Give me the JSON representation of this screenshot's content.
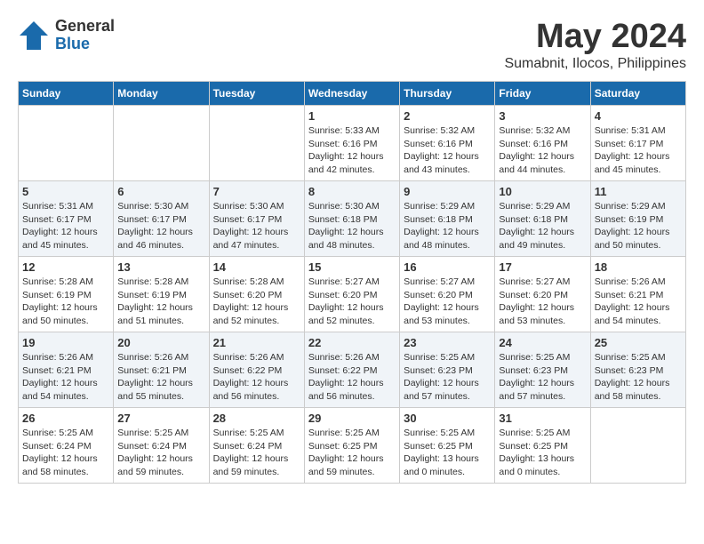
{
  "header": {
    "logo_general": "General",
    "logo_blue": "Blue",
    "month_title": "May 2024",
    "location": "Sumabnit, Ilocos, Philippines"
  },
  "weekdays": [
    "Sunday",
    "Monday",
    "Tuesday",
    "Wednesday",
    "Thursday",
    "Friday",
    "Saturday"
  ],
  "weeks": [
    {
      "alt": false,
      "days": [
        {
          "num": "",
          "sunrise": "",
          "sunset": "",
          "daylight": ""
        },
        {
          "num": "",
          "sunrise": "",
          "sunset": "",
          "daylight": ""
        },
        {
          "num": "",
          "sunrise": "",
          "sunset": "",
          "daylight": ""
        },
        {
          "num": "1",
          "sunrise": "Sunrise: 5:33 AM",
          "sunset": "Sunset: 6:16 PM",
          "daylight": "Daylight: 12 hours and 42 minutes."
        },
        {
          "num": "2",
          "sunrise": "Sunrise: 5:32 AM",
          "sunset": "Sunset: 6:16 PM",
          "daylight": "Daylight: 12 hours and 43 minutes."
        },
        {
          "num": "3",
          "sunrise": "Sunrise: 5:32 AM",
          "sunset": "Sunset: 6:16 PM",
          "daylight": "Daylight: 12 hours and 44 minutes."
        },
        {
          "num": "4",
          "sunrise": "Sunrise: 5:31 AM",
          "sunset": "Sunset: 6:17 PM",
          "daylight": "Daylight: 12 hours and 45 minutes."
        }
      ]
    },
    {
      "alt": true,
      "days": [
        {
          "num": "5",
          "sunrise": "Sunrise: 5:31 AM",
          "sunset": "Sunset: 6:17 PM",
          "daylight": "Daylight: 12 hours and 45 minutes."
        },
        {
          "num": "6",
          "sunrise": "Sunrise: 5:30 AM",
          "sunset": "Sunset: 6:17 PM",
          "daylight": "Daylight: 12 hours and 46 minutes."
        },
        {
          "num": "7",
          "sunrise": "Sunrise: 5:30 AM",
          "sunset": "Sunset: 6:17 PM",
          "daylight": "Daylight: 12 hours and 47 minutes."
        },
        {
          "num": "8",
          "sunrise": "Sunrise: 5:30 AM",
          "sunset": "Sunset: 6:18 PM",
          "daylight": "Daylight: 12 hours and 48 minutes."
        },
        {
          "num": "9",
          "sunrise": "Sunrise: 5:29 AM",
          "sunset": "Sunset: 6:18 PM",
          "daylight": "Daylight: 12 hours and 48 minutes."
        },
        {
          "num": "10",
          "sunrise": "Sunrise: 5:29 AM",
          "sunset": "Sunset: 6:18 PM",
          "daylight": "Daylight: 12 hours and 49 minutes."
        },
        {
          "num": "11",
          "sunrise": "Sunrise: 5:29 AM",
          "sunset": "Sunset: 6:19 PM",
          "daylight": "Daylight: 12 hours and 50 minutes."
        }
      ]
    },
    {
      "alt": false,
      "days": [
        {
          "num": "12",
          "sunrise": "Sunrise: 5:28 AM",
          "sunset": "Sunset: 6:19 PM",
          "daylight": "Daylight: 12 hours and 50 minutes."
        },
        {
          "num": "13",
          "sunrise": "Sunrise: 5:28 AM",
          "sunset": "Sunset: 6:19 PM",
          "daylight": "Daylight: 12 hours and 51 minutes."
        },
        {
          "num": "14",
          "sunrise": "Sunrise: 5:28 AM",
          "sunset": "Sunset: 6:20 PM",
          "daylight": "Daylight: 12 hours and 52 minutes."
        },
        {
          "num": "15",
          "sunrise": "Sunrise: 5:27 AM",
          "sunset": "Sunset: 6:20 PM",
          "daylight": "Daylight: 12 hours and 52 minutes."
        },
        {
          "num": "16",
          "sunrise": "Sunrise: 5:27 AM",
          "sunset": "Sunset: 6:20 PM",
          "daylight": "Daylight: 12 hours and 53 minutes."
        },
        {
          "num": "17",
          "sunrise": "Sunrise: 5:27 AM",
          "sunset": "Sunset: 6:20 PM",
          "daylight": "Daylight: 12 hours and 53 minutes."
        },
        {
          "num": "18",
          "sunrise": "Sunrise: 5:26 AM",
          "sunset": "Sunset: 6:21 PM",
          "daylight": "Daylight: 12 hours and 54 minutes."
        }
      ]
    },
    {
      "alt": true,
      "days": [
        {
          "num": "19",
          "sunrise": "Sunrise: 5:26 AM",
          "sunset": "Sunset: 6:21 PM",
          "daylight": "Daylight: 12 hours and 54 minutes."
        },
        {
          "num": "20",
          "sunrise": "Sunrise: 5:26 AM",
          "sunset": "Sunset: 6:21 PM",
          "daylight": "Daylight: 12 hours and 55 minutes."
        },
        {
          "num": "21",
          "sunrise": "Sunrise: 5:26 AM",
          "sunset": "Sunset: 6:22 PM",
          "daylight": "Daylight: 12 hours and 56 minutes."
        },
        {
          "num": "22",
          "sunrise": "Sunrise: 5:26 AM",
          "sunset": "Sunset: 6:22 PM",
          "daylight": "Daylight: 12 hours and 56 minutes."
        },
        {
          "num": "23",
          "sunrise": "Sunrise: 5:25 AM",
          "sunset": "Sunset: 6:23 PM",
          "daylight": "Daylight: 12 hours and 57 minutes."
        },
        {
          "num": "24",
          "sunrise": "Sunrise: 5:25 AM",
          "sunset": "Sunset: 6:23 PM",
          "daylight": "Daylight: 12 hours and 57 minutes."
        },
        {
          "num": "25",
          "sunrise": "Sunrise: 5:25 AM",
          "sunset": "Sunset: 6:23 PM",
          "daylight": "Daylight: 12 hours and 58 minutes."
        }
      ]
    },
    {
      "alt": false,
      "days": [
        {
          "num": "26",
          "sunrise": "Sunrise: 5:25 AM",
          "sunset": "Sunset: 6:24 PM",
          "daylight": "Daylight: 12 hours and 58 minutes."
        },
        {
          "num": "27",
          "sunrise": "Sunrise: 5:25 AM",
          "sunset": "Sunset: 6:24 PM",
          "daylight": "Daylight: 12 hours and 59 minutes."
        },
        {
          "num": "28",
          "sunrise": "Sunrise: 5:25 AM",
          "sunset": "Sunset: 6:24 PM",
          "daylight": "Daylight: 12 hours and 59 minutes."
        },
        {
          "num": "29",
          "sunrise": "Sunrise: 5:25 AM",
          "sunset": "Sunset: 6:25 PM",
          "daylight": "Daylight: 12 hours and 59 minutes."
        },
        {
          "num": "30",
          "sunrise": "Sunrise: 5:25 AM",
          "sunset": "Sunset: 6:25 PM",
          "daylight": "Daylight: 13 hours and 0 minutes."
        },
        {
          "num": "31",
          "sunrise": "Sunrise: 5:25 AM",
          "sunset": "Sunset: 6:25 PM",
          "daylight": "Daylight: 13 hours and 0 minutes."
        },
        {
          "num": "",
          "sunrise": "",
          "sunset": "",
          "daylight": ""
        }
      ]
    }
  ]
}
